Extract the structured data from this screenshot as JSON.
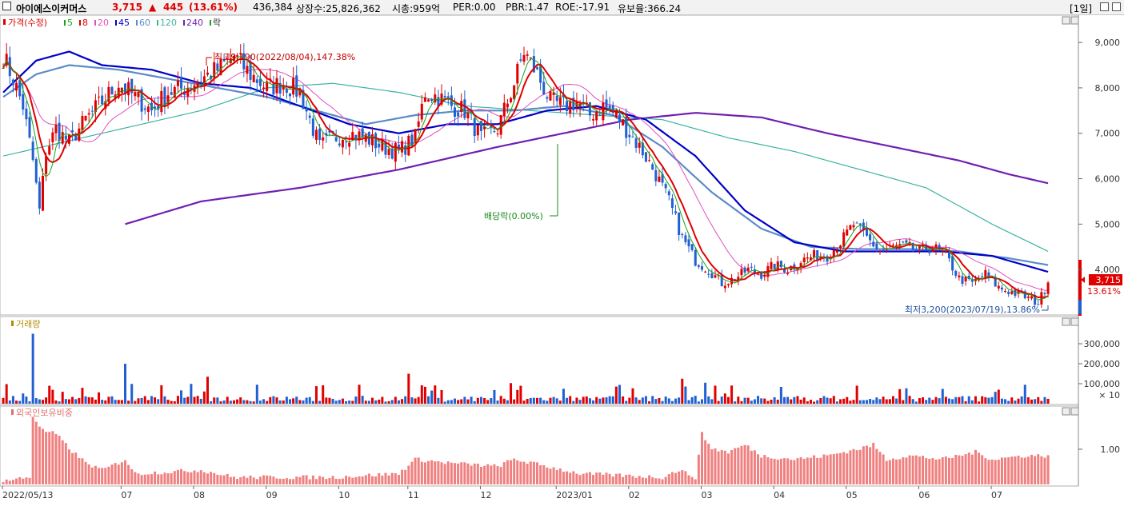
{
  "header": {
    "stock_name": "아이에스이커머스",
    "price": "3,715",
    "change_arrow": "▲",
    "change": "445",
    "change_pct": "(13.61%)",
    "volume": "436,384",
    "listed_shares": "상장수:25,826,362",
    "market_cap": "시총:959억",
    "per": "PER:0.00",
    "pbr": "PBR:1.47",
    "roe": "ROE:-17.91",
    "reserve_ratio": "유보율:366.24",
    "period_button": "[1일]",
    "icons": [
      "restore-icon",
      "close-icon"
    ]
  },
  "price_panel": {
    "legend_title": "가격(수정)",
    "ma_legend": [
      {
        "label": "5",
        "color": "#19a319"
      },
      {
        "label": "8",
        "color": "#e00000"
      },
      {
        "label": "20",
        "color": "#e050c0"
      },
      {
        "label": "45",
        "color": "#0000c8"
      },
      {
        "label": "60",
        "color": "#5a8cc8"
      },
      {
        "label": "120",
        "color": "#3cb4a0"
      },
      {
        "label": "240",
        "color": "#7020b0"
      }
    ],
    "event_legend": "락",
    "high_annotation": "최고9,190(2022/08/04),147.38%",
    "low_annotation": "최저3,200(2023/07/19),13.86%",
    "dividend_annotation": "배당락(0.00%)",
    "y_ticks": [
      "9,000",
      "8,000",
      "7,000",
      "6,000",
      "5,000",
      "4,000"
    ],
    "current_price_label": "3,715",
    "current_pct_label": "13.61%"
  },
  "volume_panel": {
    "legend_title": "거래량",
    "y_ticks": [
      "300,000",
      "200,000",
      "100,000"
    ],
    "unit_label": "× 10"
  },
  "foreign_panel": {
    "legend_title": "외국인보유비중",
    "y_ticks": [
      "1.00"
    ]
  },
  "x_axis_labels": [
    "2022/05/13",
    "07",
    "08",
    "09",
    "10",
    "11",
    "12",
    "2023/01",
    "02",
    "03",
    "04",
    "05",
    "06",
    "07"
  ],
  "chart_data": {
    "type": "candlestick",
    "title": "아이에스이커머스",
    "period": "2022/05/13 - 2023/07",
    "price_range": [
      3200,
      9190
    ],
    "ylim_price": [
      3000,
      9600
    ],
    "high": {
      "value": 9190,
      "date": "2022/08/04",
      "pct": 147.38
    },
    "low": {
      "value": 3200,
      "date": "2023/07/19",
      "pct": 13.86
    },
    "close_series": [
      [
        0,
        8700
      ],
      [
        3,
        8200
      ],
      [
        6,
        7600
      ],
      [
        9,
        6400
      ],
      [
        11,
        5300
      ],
      [
        13,
        6600
      ],
      [
        16,
        7100
      ],
      [
        20,
        6800
      ],
      [
        25,
        7300
      ],
      [
        30,
        7700
      ],
      [
        35,
        8100
      ],
      [
        40,
        7800
      ],
      [
        45,
        7500
      ],
      [
        50,
        7900
      ],
      [
        55,
        8000
      ],
      [
        60,
        8200
      ],
      [
        65,
        8400
      ],
      [
        70,
        8700
      ],
      [
        75,
        8300
      ],
      [
        80,
        8000
      ],
      [
        85,
        8100
      ],
      [
        90,
        7900
      ],
      [
        93,
        7300
      ],
      [
        96,
        6700
      ],
      [
        100,
        6900
      ],
      [
        105,
        7000
      ],
      [
        110,
        6900
      ],
      [
        115,
        6700
      ],
      [
        120,
        6600
      ],
      [
        125,
        6900
      ],
      [
        128,
        7900
      ],
      [
        132,
        7800
      ],
      [
        136,
        7600
      ],
      [
        140,
        7500
      ],
      [
        145,
        6900
      ],
      [
        150,
        7100
      ],
      [
        155,
        8100
      ],
      [
        158,
        8800
      ],
      [
        162,
        8300
      ],
      [
        166,
        7700
      ],
      [
        170,
        7600
      ],
      [
        174,
        7700
      ],
      [
        178,
        7400
      ],
      [
        182,
        7600
      ],
      [
        186,
        7400
      ],
      [
        190,
        7000
      ],
      [
        194,
        6600
      ],
      [
        198,
        6100
      ],
      [
        202,
        5500
      ],
      [
        206,
        4700
      ],
      [
        210,
        4200
      ],
      [
        214,
        4000
      ],
      [
        218,
        3700
      ],
      [
        222,
        3800
      ],
      [
        226,
        4000
      ],
      [
        230,
        3900
      ],
      [
        234,
        4100
      ],
      [
        238,
        4000
      ],
      [
        242,
        4200
      ],
      [
        246,
        4300
      ],
      [
        250,
        4300
      ],
      [
        254,
        4600
      ],
      [
        258,
        5000
      ],
      [
        262,
        4700
      ],
      [
        266,
        4400
      ],
      [
        270,
        4500
      ],
      [
        274,
        4500
      ],
      [
        278,
        4400
      ],
      [
        282,
        4500
      ],
      [
        286,
        4300
      ],
      [
        290,
        3800
      ],
      [
        294,
        3700
      ],
      [
        298,
        3900
      ],
      [
        302,
        3600
      ],
      [
        306,
        3500
      ],
      [
        310,
        3400
      ],
      [
        314,
        3270
      ],
      [
        317,
        3715
      ]
    ],
    "ma_series": {
      "ma45": [
        [
          0,
          7900
        ],
        [
          10,
          8600
        ],
        [
          20,
          8800
        ],
        [
          30,
          8500
        ],
        [
          45,
          8400
        ],
        [
          60,
          8100
        ],
        [
          75,
          8000
        ],
        [
          90,
          7600
        ],
        [
          105,
          7200
        ],
        [
          120,
          7000
        ],
        [
          135,
          7200
        ],
        [
          150,
          7200
        ],
        [
          165,
          7500
        ],
        [
          180,
          7600
        ],
        [
          195,
          7300
        ],
        [
          210,
          6500
        ],
        [
          225,
          5300
        ],
        [
          240,
          4600
        ],
        [
          255,
          4400
        ],
        [
          270,
          4400
        ],
        [
          285,
          4400
        ],
        [
          300,
          4300
        ],
        [
          317,
          3950
        ]
      ],
      "ma60": [
        [
          0,
          7800
        ],
        [
          10,
          8300
        ],
        [
          20,
          8500
        ],
        [
          35,
          8400
        ],
        [
          50,
          8200
        ],
        [
          65,
          8000
        ],
        [
          80,
          7800
        ],
        [
          95,
          7500
        ],
        [
          110,
          7200
        ],
        [
          125,
          7400
        ],
        [
          140,
          7500
        ],
        [
          155,
          7500
        ],
        [
          170,
          7600
        ],
        [
          185,
          7400
        ],
        [
          200,
          6700
        ],
        [
          215,
          5700
        ],
        [
          230,
          4900
        ],
        [
          245,
          4500
        ],
        [
          260,
          4450
        ],
        [
          275,
          4450
        ],
        [
          290,
          4400
        ],
        [
          305,
          4250
        ],
        [
          317,
          4100
        ]
      ],
      "ma120": [
        [
          0,
          6500
        ],
        [
          30,
          7000
        ],
        [
          60,
          7500
        ],
        [
          80,
          8000
        ],
        [
          100,
          8100
        ],
        [
          120,
          7900
        ],
        [
          140,
          7600
        ],
        [
          160,
          7500
        ],
        [
          180,
          7400
        ],
        [
          200,
          7300
        ],
        [
          220,
          6900
        ],
        [
          240,
          6600
        ],
        [
          260,
          6200
        ],
        [
          280,
          5800
        ],
        [
          300,
          5000
        ],
        [
          317,
          4400
        ]
      ],
      "ma240": [
        [
          37,
          5000
        ],
        [
          60,
          5500
        ],
        [
          90,
          5800
        ],
        [
          120,
          6200
        ],
        [
          150,
          6700
        ],
        [
          170,
          7000
        ],
        [
          190,
          7300
        ],
        [
          210,
          7450
        ],
        [
          230,
          7350
        ],
        [
          250,
          7000
        ],
        [
          270,
          6700
        ],
        [
          290,
          6400
        ],
        [
          305,
          6100
        ],
        [
          317,
          5900
        ]
      ]
    },
    "volume_ylim": [
      0,
      380000
    ],
    "foreign_ratio_ylim": [
      0,
      2.0
    ]
  }
}
